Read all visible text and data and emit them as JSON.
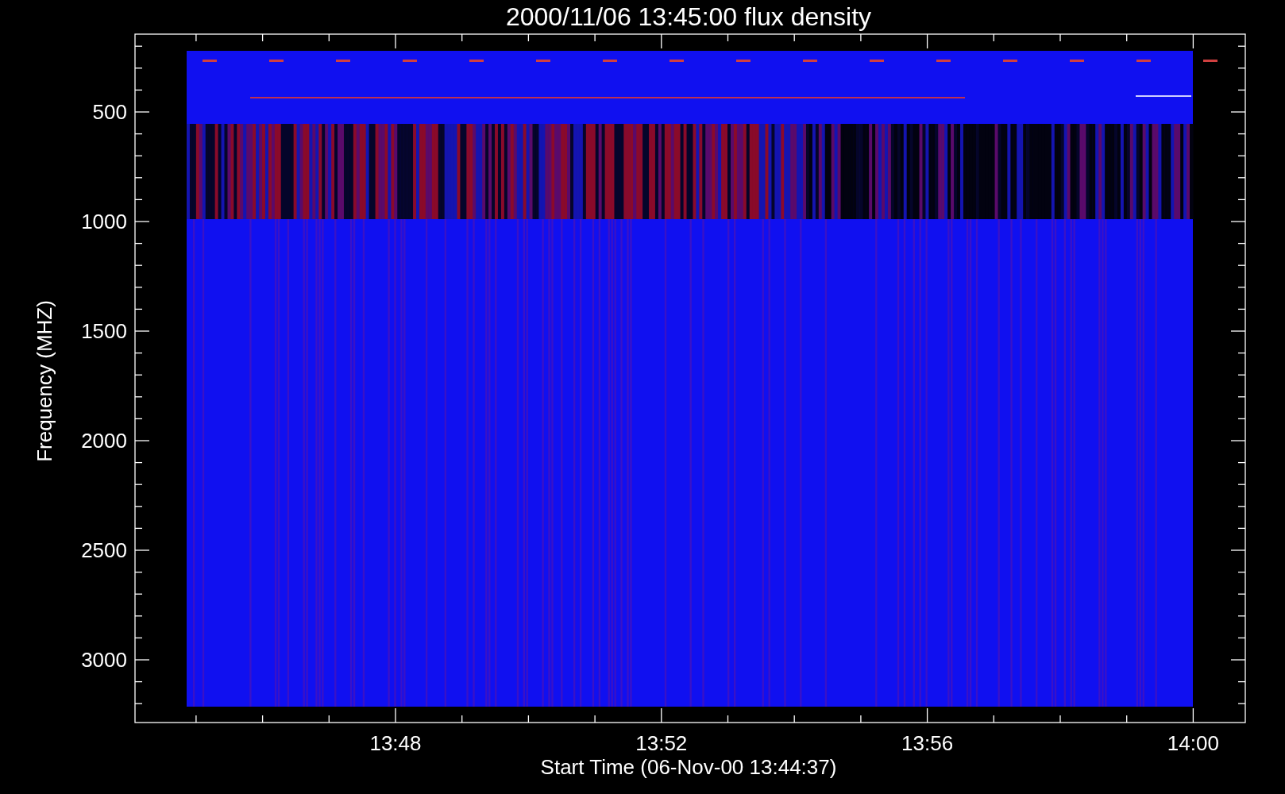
{
  "title": "2000/11/06 13:45:00 flux density",
  "y_axis": {
    "label": "Frequency (MHZ)",
    "ticks": [
      "500",
      "1000",
      "1500",
      "2000",
      "2500",
      "3000"
    ]
  },
  "x_axis": {
    "label": "Start Time (06-Nov-00 13:44:37)",
    "ticks": [
      "13:48",
      "13:52",
      "13:56",
      "14:00"
    ]
  }
}
